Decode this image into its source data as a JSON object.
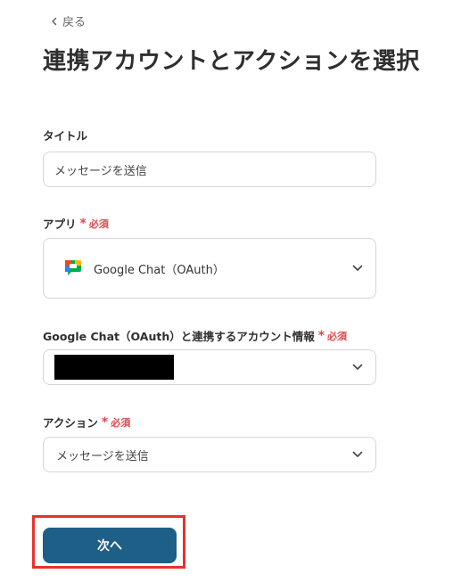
{
  "header": {
    "back_label": "戻る",
    "title": "連携アカウントとアクションを選択"
  },
  "form": {
    "title_field": {
      "label": "タイトル",
      "value": "メッセージを送信"
    },
    "app_field": {
      "label": "アプリ",
      "required": "必須",
      "value": "Google Chat（OAuth）"
    },
    "account_field": {
      "label": "Google Chat（OAuth）と連携するアカウント情報",
      "required": "必須"
    },
    "action_field": {
      "label": "アクション",
      "required": "必須",
      "value": "メッセージを送信"
    }
  },
  "next_button": {
    "label": "次へ"
  },
  "colors": {
    "primary_button": "#1d5f86",
    "required": "#e0484b",
    "highlight": "#e8322a"
  }
}
